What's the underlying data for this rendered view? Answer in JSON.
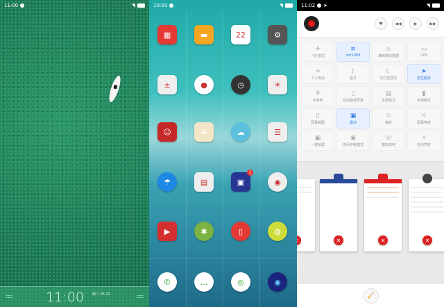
{
  "lock_screen": {
    "status_time": "11:00",
    "clock": "11:00",
    "date": "周二 05.22"
  },
  "home_screen": {
    "status_time": "10:59",
    "badge_count": "1",
    "apps": [
      {
        "name": "app-store",
        "color": "#e53935",
        "glyph": "▦"
      },
      {
        "name": "gallery",
        "color": "#f5a623",
        "glyph": "▬"
      },
      {
        "name": "calendar",
        "color": "#ffffff",
        "glyph": "22"
      },
      {
        "name": "settings",
        "color": "#555555",
        "glyph": "⚙"
      },
      {
        "name": "calculator",
        "color": "#eeeeee",
        "glyph": "±"
      },
      {
        "name": "music",
        "color": "#ffffff",
        "glyph": "●"
      },
      {
        "name": "clock",
        "color": "#333333",
        "glyph": "◷"
      },
      {
        "name": "display-settings",
        "color": "#eeeeee",
        "glyph": "☀"
      },
      {
        "name": "contacts",
        "color": "#c62828",
        "glyph": "☺"
      },
      {
        "name": "notes",
        "color": "#f3e6c8",
        "glyph": "≡"
      },
      {
        "name": "weather",
        "color": "#5bc0de",
        "glyph": "☁"
      },
      {
        "name": "toggles",
        "color": "#eeeeee",
        "glyph": "☰"
      },
      {
        "name": "browser",
        "color": "#1e88e5",
        "glyph": "☂"
      },
      {
        "name": "file-manager",
        "color": "#eeeeee",
        "glyph": "▤"
      },
      {
        "name": "security",
        "color": "#283593",
        "glyph": "▣"
      },
      {
        "name": "music-player",
        "color": "#eeeeee",
        "glyph": "◉"
      },
      {
        "name": "video",
        "color": "#d32f2f",
        "glyph": "▶"
      },
      {
        "name": "android",
        "color": "#7cb342",
        "glyph": "✱"
      },
      {
        "name": "phone-manager",
        "color": "#e53935",
        "glyph": "▯"
      },
      {
        "name": "radio",
        "color": "#cddc39",
        "glyph": "◍"
      }
    ],
    "dock": [
      {
        "name": "phone",
        "color": "#ffffff",
        "glyph": "✆"
      },
      {
        "name": "messages",
        "color": "#ffffff",
        "glyph": "…"
      },
      {
        "name": "wechat",
        "color": "#ffffff",
        "glyph": "◎"
      },
      {
        "name": "camera",
        "color": "#1a237e",
        "glyph": "◉"
      }
    ]
  },
  "control_center": {
    "status_time": "11:02",
    "media": {
      "like": "♥",
      "prev": "◀◀",
      "play": "▶",
      "next": "▶▶"
    },
    "tiles": [
      {
        "label": "飞行模式",
        "icon": "✈",
        "on": false
      },
      {
        "label": "dxt1008",
        "icon": "≋",
        "on": true
      },
      {
        "label": "蜂窝移动数据",
        "icon": "⍝",
        "on": false
      },
      {
        "label": "VPN",
        "icon": "▭",
        "on": false
      },
      {
        "label": "个人热点",
        "icon": "∞",
        "on": false
      },
      {
        "label": "蓝牙",
        "icon": "ᛒ",
        "on": false
      },
      {
        "label": "勿打扰模式",
        "icon": "☾",
        "on": false
      },
      {
        "label": "定位服务",
        "icon": "➤",
        "on": true
      },
      {
        "label": "手电筒",
        "icon": "♆",
        "on": false
      },
      {
        "label": "自动旋转屏幕",
        "icon": "▯",
        "on": false
      },
      {
        "label": "多屏模式",
        "icon": "▤",
        "on": false
      },
      {
        "label": "省电模式",
        "icon": "▮",
        "on": false
      },
      {
        "label": "屏幕截图",
        "icon": "▯",
        "on": false
      },
      {
        "label": "震动",
        "icon": "▣",
        "on": true
      },
      {
        "label": "静音",
        "icon": "⍉",
        "on": false
      },
      {
        "label": "屏幕亮度",
        "icon": "☼",
        "on": false
      },
      {
        "label": "一键锁屏",
        "icon": "▣",
        "on": false
      },
      {
        "label": "夜间护眼模式",
        "icon": "◉",
        "on": false
      },
      {
        "label": "模拟来电",
        "icon": "☏",
        "on": false
      },
      {
        "label": "自动亮度",
        "icon": "☼",
        "on": false
      }
    ],
    "close_glyph": "✕",
    "clean_glyph": "🧹"
  }
}
